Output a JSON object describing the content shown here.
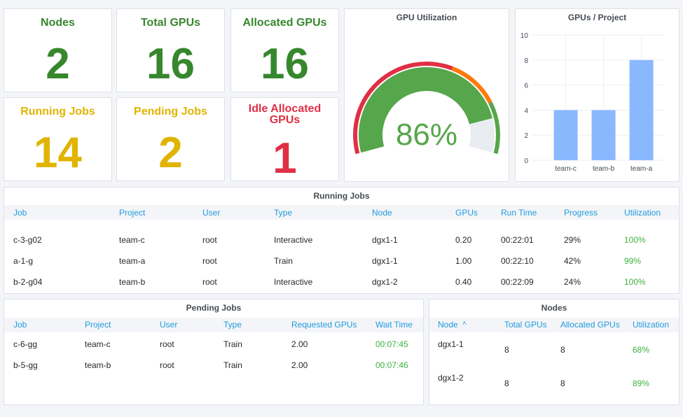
{
  "stats": [
    {
      "title": "Nodes",
      "value": "2",
      "color": "#37872d"
    },
    {
      "title": "Total GPUs",
      "value": "16",
      "color": "#37872d"
    },
    {
      "title": "Allocated GPUs",
      "value": "16",
      "color": "#37872d"
    },
    {
      "title": "Running Jobs",
      "value": "14",
      "color": "#e0b400"
    },
    {
      "title": "Pending Jobs",
      "value": "2",
      "color": "#e0b400"
    },
    {
      "title": "Idle Allocated GPUs",
      "value": "1",
      "color": "#e02f44"
    }
  ],
  "gauge": {
    "title": "GPU Utilization",
    "value": 86,
    "display": "86%",
    "min": 0,
    "max": 100,
    "thresholds": [
      {
        "from": 0,
        "color": "#e02f44"
      },
      {
        "from": 60,
        "color": "#ff780a"
      },
      {
        "from": 80,
        "color": "#56a64b"
      }
    ],
    "value_color": "#56a64b"
  },
  "chart_data": {
    "type": "bar",
    "title": "GPUs / Project",
    "categories": [
      "team-c",
      "team-b",
      "team-a"
    ],
    "values": [
      4,
      4,
      8
    ],
    "ylim": [
      0,
      10
    ],
    "yticks": [
      "0",
      "2",
      "4",
      "6",
      "8",
      "10"
    ],
    "grid": true,
    "color": "#8ab8ff"
  },
  "running": {
    "title": "Running Jobs",
    "headers": [
      "Job",
      "Project",
      "User",
      "Type",
      "Node",
      "GPUs",
      "Run Time",
      "Progress",
      "Utilization"
    ],
    "rows": [
      [
        "c-3-g02",
        "team-c",
        "root",
        "Interactive",
        "dgx1-1",
        "0.20",
        "00:22:01",
        "29%",
        "100%"
      ],
      [
        "a-1-g",
        "team-a",
        "root",
        "Train",
        "dgx1-1",
        "1.00",
        "00:22:10",
        "42%",
        "99%"
      ],
      [
        "b-2-g04",
        "team-b",
        "root",
        "Interactive",
        "dgx1-2",
        "0.40",
        "00:22:09",
        "24%",
        "100%"
      ]
    ]
  },
  "pending": {
    "title": "Pending Jobs",
    "headers": [
      "Job",
      "Project",
      "User",
      "Type",
      "Requested GPUs",
      "Wait Time"
    ],
    "rows": [
      [
        "c-6-gg",
        "team-c",
        "root",
        "Train",
        "2.00",
        "00:07:45"
      ],
      [
        "b-5-gg",
        "team-b",
        "root",
        "Train",
        "2.00",
        "00:07:46"
      ]
    ]
  },
  "nodes": {
    "title": "Nodes",
    "sort_icon": "chevron-up-icon",
    "headers": [
      "Node",
      "Total GPUs",
      "Allocated GPUs",
      "Utilization"
    ],
    "rows": [
      [
        "dgx1-1",
        "8",
        "8",
        "68%"
      ],
      [
        "dgx1-2",
        "8",
        "8",
        "89%"
      ]
    ]
  }
}
